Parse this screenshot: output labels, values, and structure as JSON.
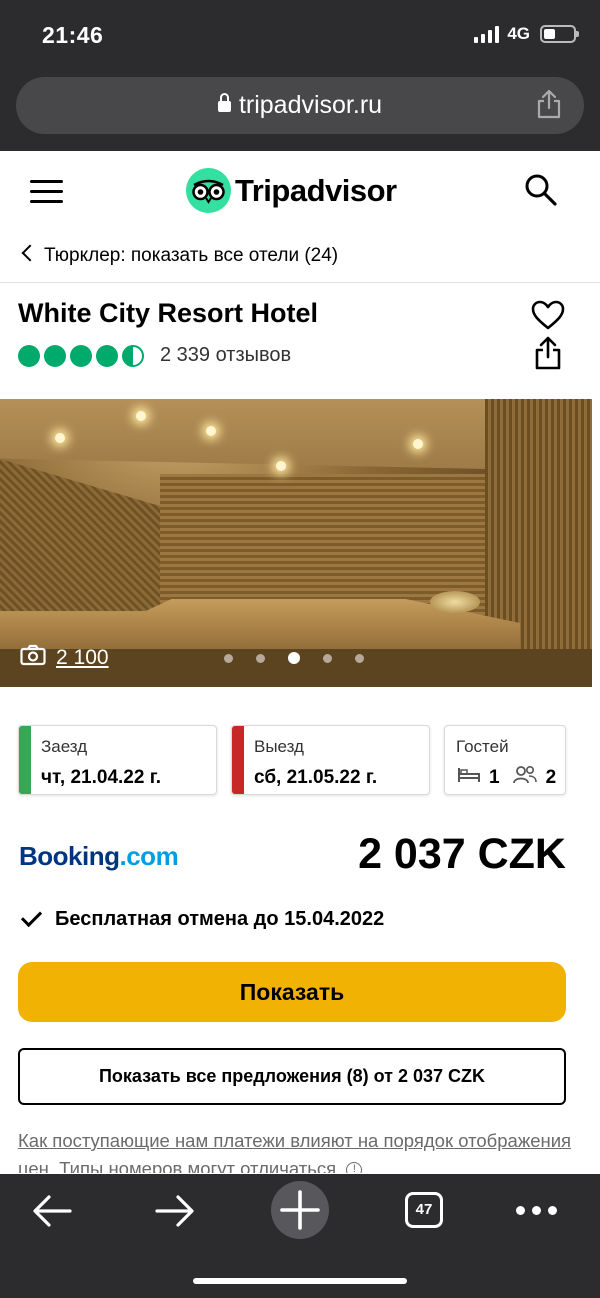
{
  "status_bar": {
    "time": "21:46",
    "network": "4G"
  },
  "browser": {
    "url": "tripadvisor.ru",
    "tab_count": "47"
  },
  "site": {
    "logo_text": "Tripadvisor",
    "brand_color": "#34e0a1"
  },
  "breadcrumb": {
    "text": "Тюрклер: показать все отели (24)"
  },
  "hotel": {
    "name": "White City Resort Hotel",
    "rating": 4.5,
    "reviews": "2 339 отзывов",
    "photo_count": "2 100",
    "photo_index": 3,
    "photo_total": 5
  },
  "dates": {
    "checkin_label": "Заезд",
    "checkin_value": "чт, 21.04.22 г.",
    "checkin_color": "#34a853",
    "checkout_label": "Выезд",
    "checkout_value": "сб, 21.05.22 г.",
    "checkout_color": "#c62828",
    "guests_label": "Гостей",
    "rooms": "1",
    "guests": "2"
  },
  "offer": {
    "provider_main": "Booking",
    "provider_suffix": ".com",
    "price": "2 037 CZK",
    "cancellation": "Бесплатная отмена до 15.04.2022",
    "show_label": "Показать",
    "all_offers_label": "Показать все предложения (8) от 2 037 CZK",
    "button_color": "#f2b203"
  },
  "disclaimer": "Как поступающие нам платежи влияют на порядок отображения цен. Типы номеров могут отличаться."
}
